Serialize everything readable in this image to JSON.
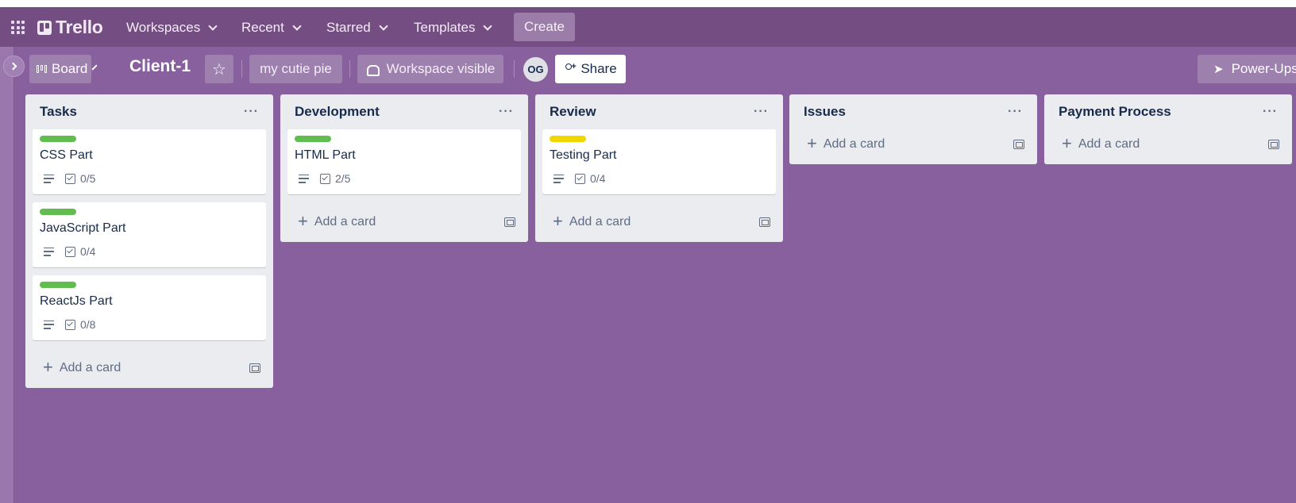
{
  "topbar": {
    "logo": "Trello",
    "nav": [
      "Workspaces",
      "Recent",
      "Starred",
      "Templates"
    ],
    "create": "Create"
  },
  "board_header": {
    "view": "Board",
    "title": "Client-1",
    "tag": "my cutie pie",
    "visibility": "Workspace visible",
    "avatar_initials": "OG",
    "share": "Share",
    "powerups": "Power-Ups"
  },
  "colors": {
    "green": "#61bd4f",
    "yellow": "#f2d600",
    "topbar": "#744e82",
    "board": "#89609e"
  },
  "lists": [
    {
      "title": "Tasks",
      "cards": [
        {
          "label": "green",
          "title": "CSS Part",
          "checklist": "0/5"
        },
        {
          "label": "green",
          "title": "JavaScript Part",
          "checklist": "0/4"
        },
        {
          "label": "green",
          "title": "ReactJs Part",
          "checklist": "0/8"
        }
      ],
      "add": "Add a card"
    },
    {
      "title": "Development",
      "cards": [
        {
          "label": "green",
          "title": "HTML Part",
          "checklist": "2/5"
        }
      ],
      "add": "Add a card"
    },
    {
      "title": "Review",
      "cards": [
        {
          "label": "yellow",
          "title": "Testing Part",
          "checklist": "0/4"
        }
      ],
      "add": "Add a card"
    },
    {
      "title": "Issues",
      "cards": [],
      "add": "Add a card"
    },
    {
      "title": "Payment Process",
      "cards": [],
      "add": "Add a card"
    }
  ]
}
